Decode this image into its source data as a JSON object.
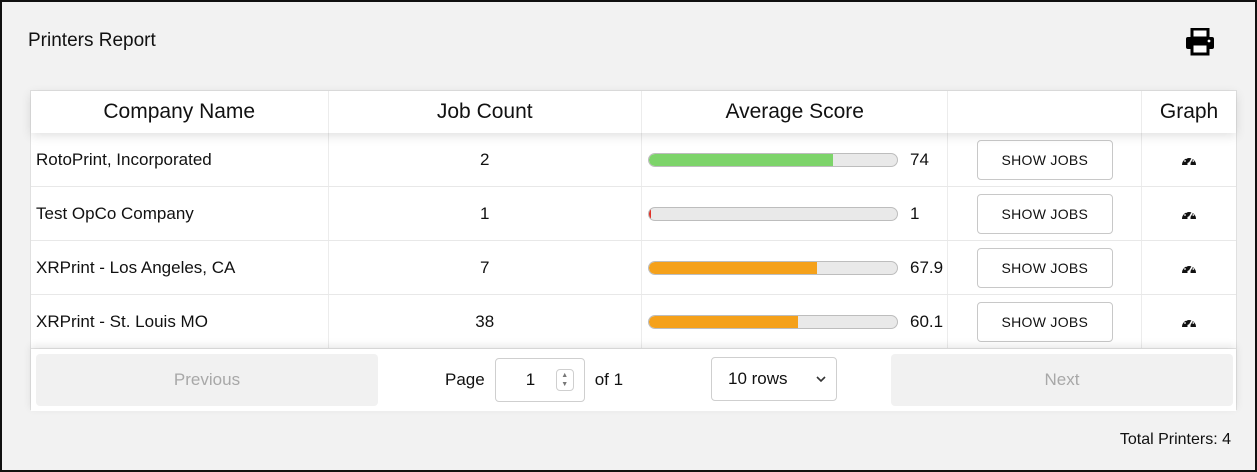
{
  "report": {
    "title": "Printers Report",
    "print_icon": "printer-icon"
  },
  "table": {
    "headers": [
      "Company Name",
      "Job Count",
      "Average Score",
      "",
      "Graph"
    ],
    "rows": [
      {
        "company": "RotoPrint, Incorporated",
        "jobs": "2",
        "score": "74",
        "score_fraction": 0.74,
        "bar_color": "#7dd46a",
        "action": "SHOW JOBS",
        "graph_icon": "dashboard-gauge-icon"
      },
      {
        "company": "Test OpCo Company",
        "jobs": "1",
        "score": "1",
        "score_fraction": 0.01,
        "bar_color": "#e0342a",
        "action": "SHOW JOBS",
        "graph_icon": "dashboard-gauge-icon"
      },
      {
        "company": "XRPrint - Los Angeles, CA",
        "jobs": "7",
        "score": "67.9",
        "score_fraction": 0.679,
        "bar_color": "#f5a11a",
        "action": "SHOW JOBS",
        "graph_icon": "dashboard-gauge-icon"
      },
      {
        "company": "XRPrint - St. Louis MO",
        "jobs": "38",
        "score": "60.1",
        "score_fraction": 0.601,
        "bar_color": "#f5a11a",
        "action": "SHOW JOBS",
        "graph_icon": "dashboard-gauge-icon"
      }
    ]
  },
  "pagination": {
    "previous": "Previous",
    "page_label": "Page",
    "page_value": "1",
    "of_label": "of 1",
    "rows_select": "10 rows",
    "next": "Next"
  },
  "footer": {
    "total": "Total Printers: 4"
  }
}
